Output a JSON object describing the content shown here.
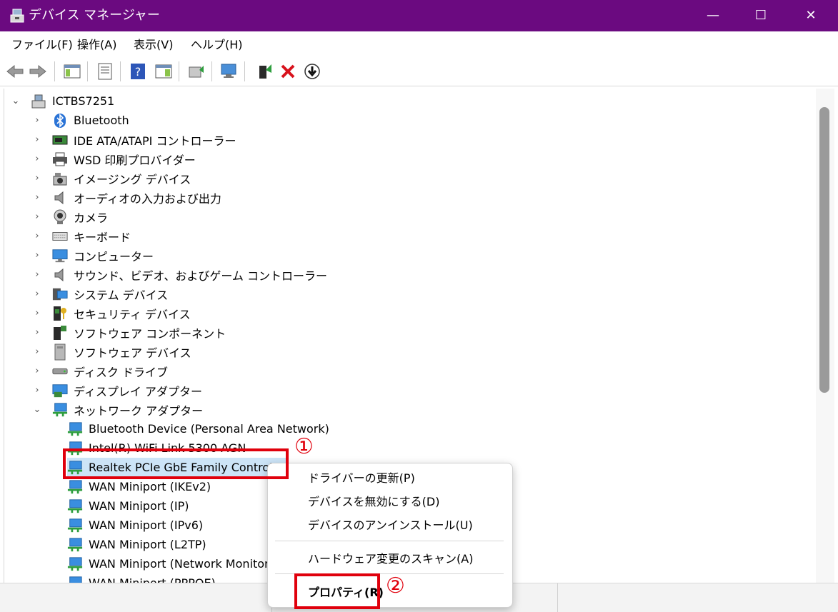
{
  "window": {
    "title": "デバイス マネージャー",
    "controls": {
      "minimize": "—",
      "maximize": "☐",
      "close": "✕"
    }
  },
  "menubar": {
    "items": [
      "ファイル(F)",
      "操作(A)",
      "表示(V)",
      "ヘルプ(H)"
    ]
  },
  "toolbar": {
    "icons": [
      "back-arrow-icon",
      "forward-arrow-icon",
      "show-hide-tree-icon",
      "properties-icon",
      "help-icon",
      "action-pane-icon",
      "update-driver-icon",
      "scan-hardware-icon",
      "enable-device-icon",
      "uninstall-icon",
      "download-icon"
    ]
  },
  "tree": {
    "root": "ICTBS7251",
    "categories": [
      {
        "label": "Bluetooth",
        "icon": "bluetooth-icon"
      },
      {
        "label": "IDE ATA/ATAPI コントローラー",
        "icon": "ide-controller-icon"
      },
      {
        "label": "WSD 印刷プロバイダー",
        "icon": "printer-icon"
      },
      {
        "label": "イメージング デバイス",
        "icon": "camera-scanner-icon"
      },
      {
        "label": "オーディオの入力および出力",
        "icon": "speaker-icon"
      },
      {
        "label": "カメラ",
        "icon": "webcam-icon"
      },
      {
        "label": "キーボード",
        "icon": "keyboard-icon"
      },
      {
        "label": "コンピューター",
        "icon": "monitor-icon"
      },
      {
        "label": "サウンド、ビデオ、およびゲーム コントローラー",
        "icon": "speaker-icon"
      },
      {
        "label": "システム デバイス",
        "icon": "system-device-icon"
      },
      {
        "label": "セキュリティ デバイス",
        "icon": "security-key-icon"
      },
      {
        "label": "ソフトウェア コンポーネント",
        "icon": "software-component-icon"
      },
      {
        "label": "ソフトウェア デバイス",
        "icon": "software-device-icon"
      },
      {
        "label": "ディスク ドライブ",
        "icon": "disk-drive-icon"
      },
      {
        "label": "ディスプレイ アダプター",
        "icon": "display-adapter-icon"
      },
      {
        "label": "ネットワーク アダプター",
        "icon": "network-icon"
      }
    ],
    "network_adapters": [
      "Bluetooth Device (Personal Area Network)",
      "Intel(R) WiFi Link 5300 AGN",
      "Realtek PCIe GbE Family Controller",
      "WAN Miniport (IKEv2)",
      "WAN Miniport (IP)",
      "WAN Miniport (IPv6)",
      "WAN Miniport (L2TP)",
      "WAN Miniport (Network Monitor)",
      "WAN Miniport (PPPOE)"
    ],
    "selected_index": 2
  },
  "context_menu": {
    "update_driver": "ドライバーの更新(P)",
    "disable": "デバイスを無効にする(D)",
    "uninstall": "デバイスのアンインストール(U)",
    "scan": "ハードウェア変更のスキャン(A)",
    "properties": "プロパティ(R)"
  },
  "annotations": {
    "step1": "①",
    "step2": "②",
    "color": "#e0000c"
  }
}
